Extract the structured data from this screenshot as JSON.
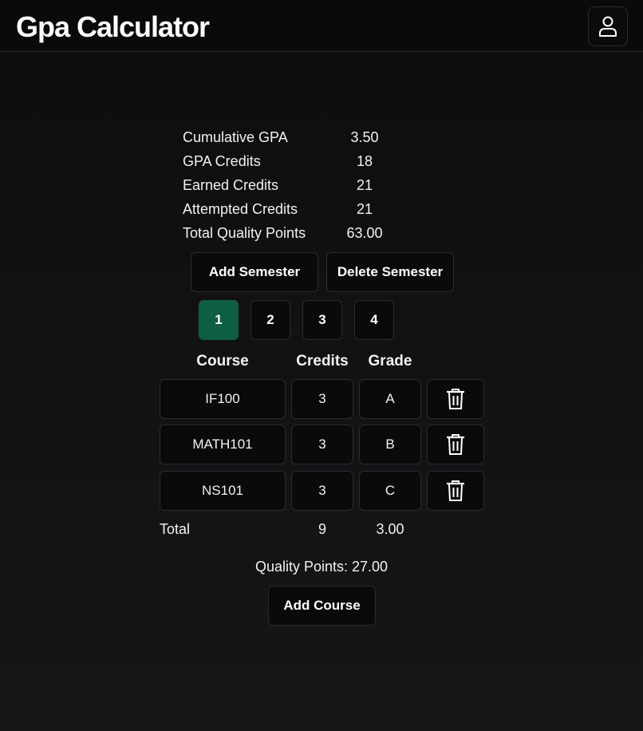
{
  "app": {
    "title": "Gpa Calculator",
    "accent_color": "#0e5e45",
    "profile_icon": "user-icon"
  },
  "summary": [
    {
      "label": "Cumulative GPA",
      "value": "3.50"
    },
    {
      "label": "GPA Credits",
      "value": "18"
    },
    {
      "label": "Earned Credits",
      "value": "21"
    },
    {
      "label": "Attempted Credits",
      "value": "21"
    },
    {
      "label": "Total Quality Points",
      "value": "63.00"
    }
  ],
  "semester_actions": {
    "add_label": "Add Semester",
    "delete_label": "Delete Semester"
  },
  "semesters": {
    "tabs": [
      "1",
      "2",
      "3",
      "4"
    ],
    "active": "1"
  },
  "table": {
    "headers": {
      "course": "Course",
      "credits": "Credits",
      "grade": "Grade"
    },
    "rows": [
      {
        "course": "IF100",
        "credits": "3",
        "grade": "A"
      },
      {
        "course": "MATH101",
        "credits": "3",
        "grade": "B"
      },
      {
        "course": "NS101",
        "credits": "3",
        "grade": "C"
      }
    ],
    "total": {
      "label": "Total",
      "credits": "9",
      "gpa": "3.00"
    }
  },
  "quality_points": "Quality Points: 27.00",
  "add_course_label": "Add Course"
}
